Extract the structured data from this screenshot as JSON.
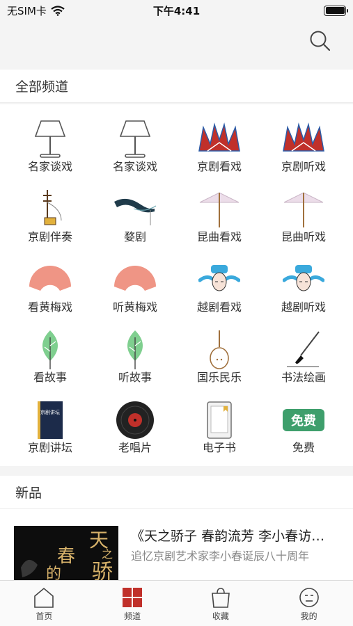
{
  "status_bar": {
    "carrier": "无SIM卡",
    "time": "下午4:41"
  },
  "sections": {
    "all_channels": "全部频道",
    "new_items": "新品"
  },
  "channels": [
    {
      "label": "名家谈戏",
      "icon": "lamp-icon"
    },
    {
      "label": "名家谈戏",
      "icon": "lamp-icon"
    },
    {
      "label": "京剧看戏",
      "icon": "opera-crown-icon"
    },
    {
      "label": "京剧听戏",
      "icon": "opera-crown-icon"
    },
    {
      "label": "京剧伴奏",
      "icon": "erhu-icon"
    },
    {
      "label": "婺剧",
      "icon": "ink-stroke-icon"
    },
    {
      "label": "昆曲看戏",
      "icon": "parasol-icon"
    },
    {
      "label": "昆曲听戏",
      "icon": "parasol-icon"
    },
    {
      "label": "看黄梅戏",
      "icon": "fan-icon"
    },
    {
      "label": "听黄梅戏",
      "icon": "fan-icon"
    },
    {
      "label": "越剧看戏",
      "icon": "opera-face-icon"
    },
    {
      "label": "越剧听戏",
      "icon": "opera-face-icon"
    },
    {
      "label": "看故事",
      "icon": "leaf-icon"
    },
    {
      "label": "听故事",
      "icon": "leaf-icon"
    },
    {
      "label": "国乐民乐",
      "icon": "pipa-icon"
    },
    {
      "label": "书法绘画",
      "icon": "brush-icon"
    },
    {
      "label": "京剧讲坛",
      "icon": "book-icon",
      "icon_text": "京剧讲坛"
    },
    {
      "label": "老唱片",
      "icon": "vinyl-record-icon"
    },
    {
      "label": "电子书",
      "icon": "ebook-icon"
    },
    {
      "label": "免费",
      "icon": "free-badge-icon",
      "icon_text": "免费"
    }
  ],
  "new_item": {
    "title": "《天之骄子 春韵流芳 李小春访…",
    "subtitle": "追忆京剧艺术家李小春诞辰八十周年",
    "thumb_text": [
      "天",
      "之",
      "骄",
      "春",
      "的"
    ]
  },
  "tabs": [
    {
      "label": "首页",
      "icon": "home-icon",
      "active": false
    },
    {
      "label": "频道",
      "icon": "grid-icon",
      "active": true
    },
    {
      "label": "收藏",
      "icon": "bag-icon",
      "active": false
    },
    {
      "label": "我的",
      "icon": "profile-icon",
      "active": false
    }
  ],
  "colors": {
    "accent": "#c0302a",
    "leaf": "#7fcf8f",
    "fan": "#ef9585",
    "free_badge": "#3e9f6c"
  }
}
